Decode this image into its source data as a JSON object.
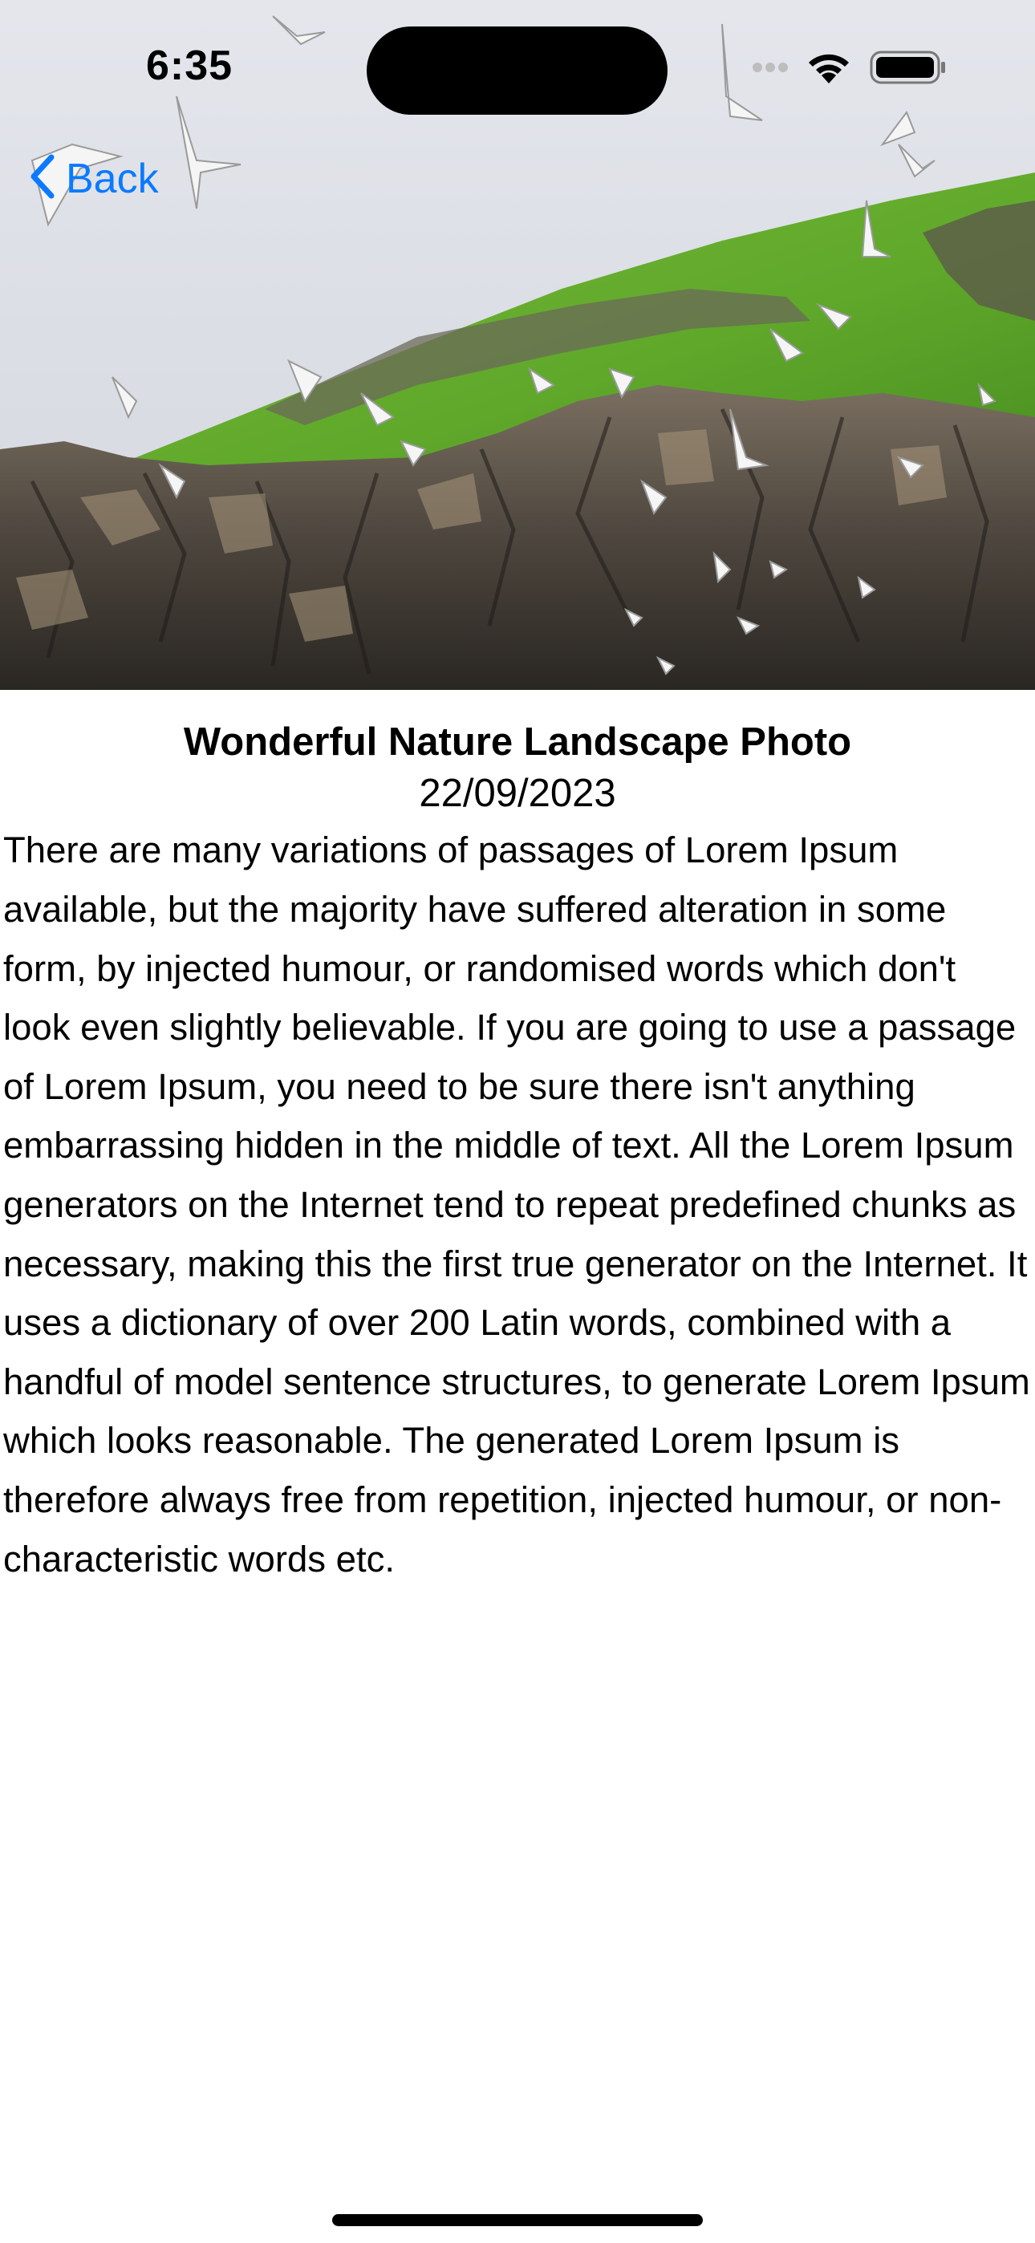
{
  "status_bar": {
    "time": "6:35",
    "icons": [
      "cellular-dots-icon",
      "wifi-icon",
      "battery-icon"
    ]
  },
  "navigation": {
    "back_label": "Back",
    "back_icon": "chevron-left-icon",
    "accent_color": "#0a7aff"
  },
  "hero_image": {
    "subject": "seagulls flying over rocky cliff with green hillside",
    "icon": "landscape-photo"
  },
  "article": {
    "title": "Wonderful Nature Landscape Photo",
    "date": "22/09/2023",
    "body": "There are many variations of passages of Lorem Ipsum available, but the majority have suffered alteration in some form, by injected humour, or randomised words which don't look even slightly believable. If you are going to use a passage of Lorem Ipsum, you need to be sure there isn't anything embarrassing hidden in the middle of text. All the Lorem Ipsum generators on the Internet tend to repeat predefined chunks as necessary, making this the first true generator on the Internet. It uses a dictionary of over 200 Latin words, combined with a handful of model sentence structures, to generate Lorem Ipsum which looks reasonable. The generated Lorem Ipsum is therefore always free from repetition, injected humour, or non-characteristic words etc."
  }
}
